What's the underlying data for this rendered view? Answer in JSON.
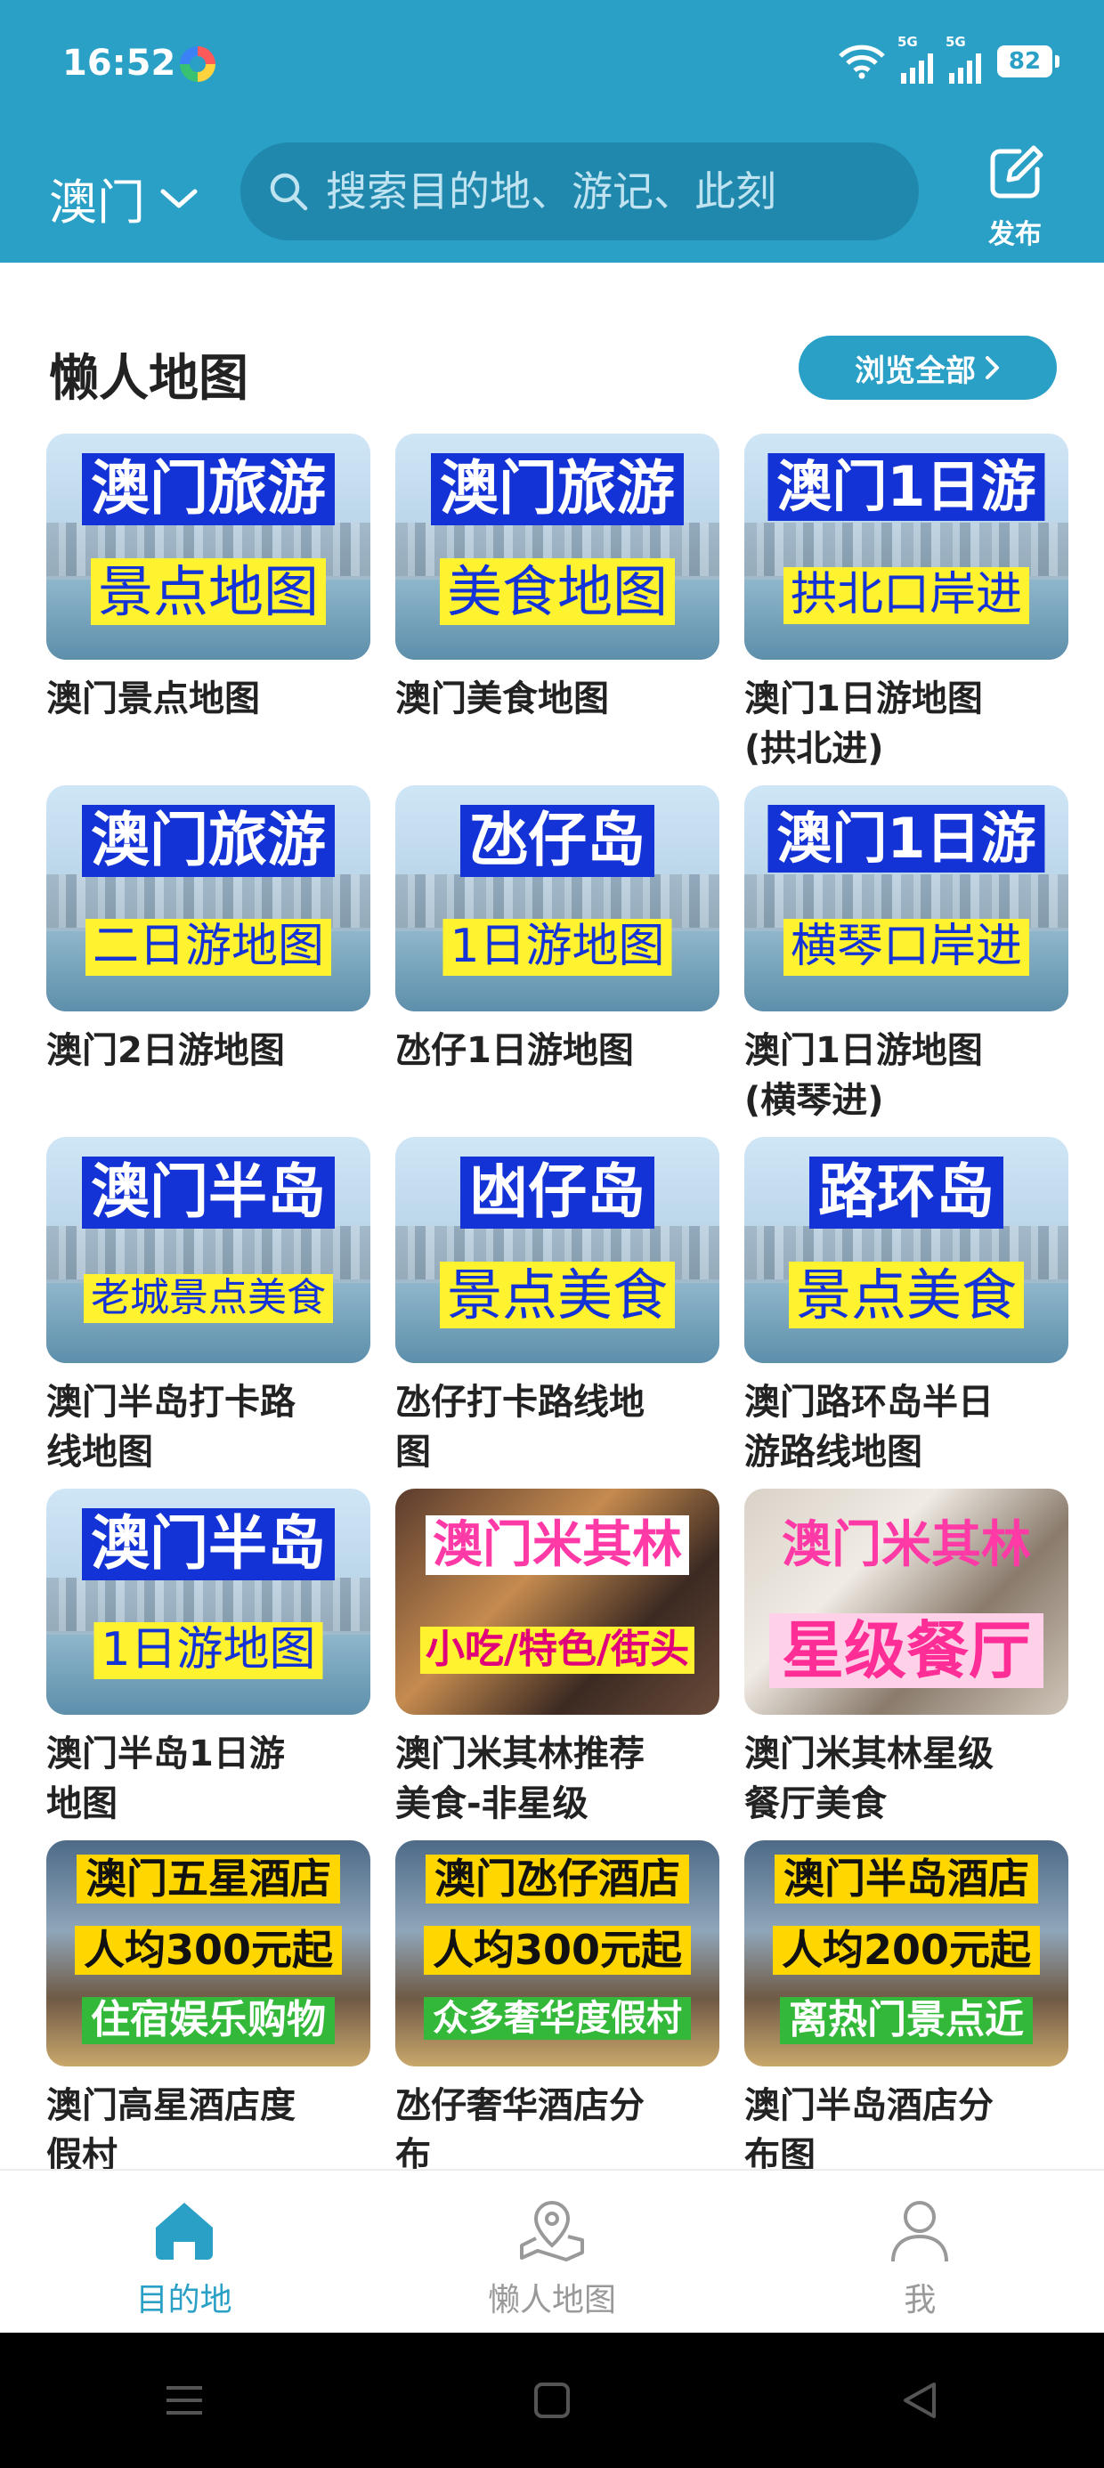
{
  "status_bar": {
    "time": "16:52",
    "signal1": "5G",
    "signal2": "5G",
    "battery": "82"
  },
  "header": {
    "city": "澳门",
    "search_placeholder": "搜索目的地、游记、此刻",
    "publish_label": "发布"
  },
  "section": {
    "title": "懒人地图",
    "browse_all": "浏览全部"
  },
  "cards": [
    {
      "tag1": "澳门旅游",
      "tag2": "景点地图",
      "label1": "澳门景点地图",
      "label2": ""
    },
    {
      "tag1": "澳门旅游",
      "tag2": "美食地图",
      "label1": "澳门美食地图",
      "label2": ""
    },
    {
      "tag1": "澳门1日游",
      "tag2": "拱北口岸进",
      "label1": "澳门1日游地图",
      "label2": "(拱北进)"
    },
    {
      "tag1": "澳门旅游",
      "tag2": "二日游地图",
      "label1": "澳门2日游地图",
      "label2": ""
    },
    {
      "tag1": "氹仔岛",
      "tag2": "1日游地图",
      "label1": "氹仔1日游地图",
      "label2": ""
    },
    {
      "tag1": "澳门1日游",
      "tag2": "横琴口岸进",
      "label1": "澳门1日游地图",
      "label2": "(横琴进)"
    },
    {
      "tag1": "澳门半岛",
      "tag2": "老城景点美食",
      "label1": "澳门半岛打卡路",
      "label2": "线地图"
    },
    {
      "tag1": "凼仔岛",
      "tag2": "景点美食",
      "label1": "氹仔打卡路线地",
      "label2": "图"
    },
    {
      "tag1": "路环岛",
      "tag2": "景点美食",
      "label1": "澳门路环岛半日",
      "label2": "游路线地图"
    },
    {
      "tag1": "澳门半岛",
      "tag2": "1日游地图",
      "label1": "澳门半岛1日游",
      "label2": "地图"
    },
    {
      "tag1": "澳门米其林",
      "tag2": "小吃/特色/街头",
      "label1": "澳门米其林推荐",
      "label2": "美食-非星级"
    },
    {
      "tag1": "澳门米其林",
      "tag2": "星级餐厅",
      "label1": "澳门米其林星级",
      "label2": "餐厅美食"
    },
    {
      "tag1": "澳门五星酒店",
      "tag2": "人均300元起",
      "tag3": "住宿娱乐购物",
      "label1": "澳门高星酒店度",
      "label2": "假村"
    },
    {
      "tag1": "澳门氹仔酒店",
      "tag2": "人均300元起",
      "tag3": "众多奢华度假村",
      "label1": "氹仔奢华酒店分",
      "label2": "布"
    },
    {
      "tag1": "澳门半岛酒店",
      "tag2": "人均200元起",
      "tag3": "离热门景点近",
      "label1": "澳门半岛酒店分",
      "label2": "布图"
    }
  ],
  "tabbar": {
    "tab1": "目的地",
    "tab2": "懒人地图",
    "tab3": "我"
  }
}
